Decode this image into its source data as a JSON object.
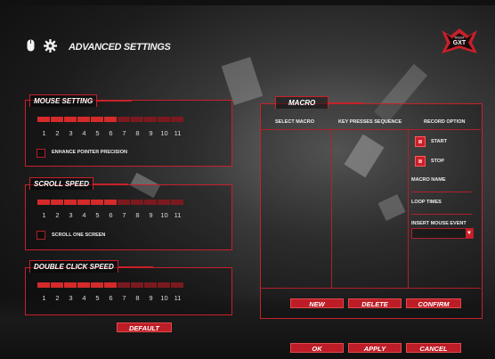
{
  "header": {
    "title": "ADVANCED SETTINGS",
    "mouse_icon": "mouse-icon",
    "gear_icon": "gear-icon"
  },
  "logo": {
    "small_text": "TRUST",
    "brand_text": "GXT"
  },
  "colors": {
    "accent": "#c8202a",
    "slider_on": "#d42a2a",
    "slider_off": "#7a1a1f"
  },
  "mouse_setting": {
    "title": "MOUSE SETTING",
    "ticks": [
      "1",
      "2",
      "3",
      "4",
      "5",
      "6",
      "7",
      "8",
      "9",
      "10",
      "11"
    ],
    "level": 6,
    "checkbox_label": "ENHANCE POINTER PRECISION"
  },
  "scroll_speed": {
    "title": "SCROLL SPEED",
    "ticks": [
      "1",
      "2",
      "3",
      "4",
      "5",
      "6",
      "7",
      "8",
      "9",
      "10",
      "11"
    ],
    "level": 6,
    "checkbox_label": "SCROLL ONE SCREEN"
  },
  "double_click_speed": {
    "title": "DOUBLE CLICK SPEED",
    "ticks": [
      "1",
      "2",
      "3",
      "4",
      "5",
      "6",
      "7",
      "8",
      "9",
      "10",
      "11"
    ],
    "level": 6
  },
  "macro": {
    "title": "MACRO",
    "col_select": "SELECT MACRO",
    "col_keys": "KEY PRESSES SEQUENCE",
    "col_record": "RECORD OPTION",
    "start_label": "START",
    "stop_label": "STOP",
    "macro_name_label": "MACRO NAME",
    "loop_times_label": "LOOP TIMES",
    "insert_event_label": "INSERT MOUSE EVENT",
    "btn_new": "NEW",
    "btn_delete": "DELETE",
    "btn_confirm": "CONFIRM"
  },
  "footer": {
    "btn_default": "DEFAULT",
    "btn_ok": "OK",
    "btn_apply": "APPLY",
    "btn_cancel": "CANCEL"
  }
}
